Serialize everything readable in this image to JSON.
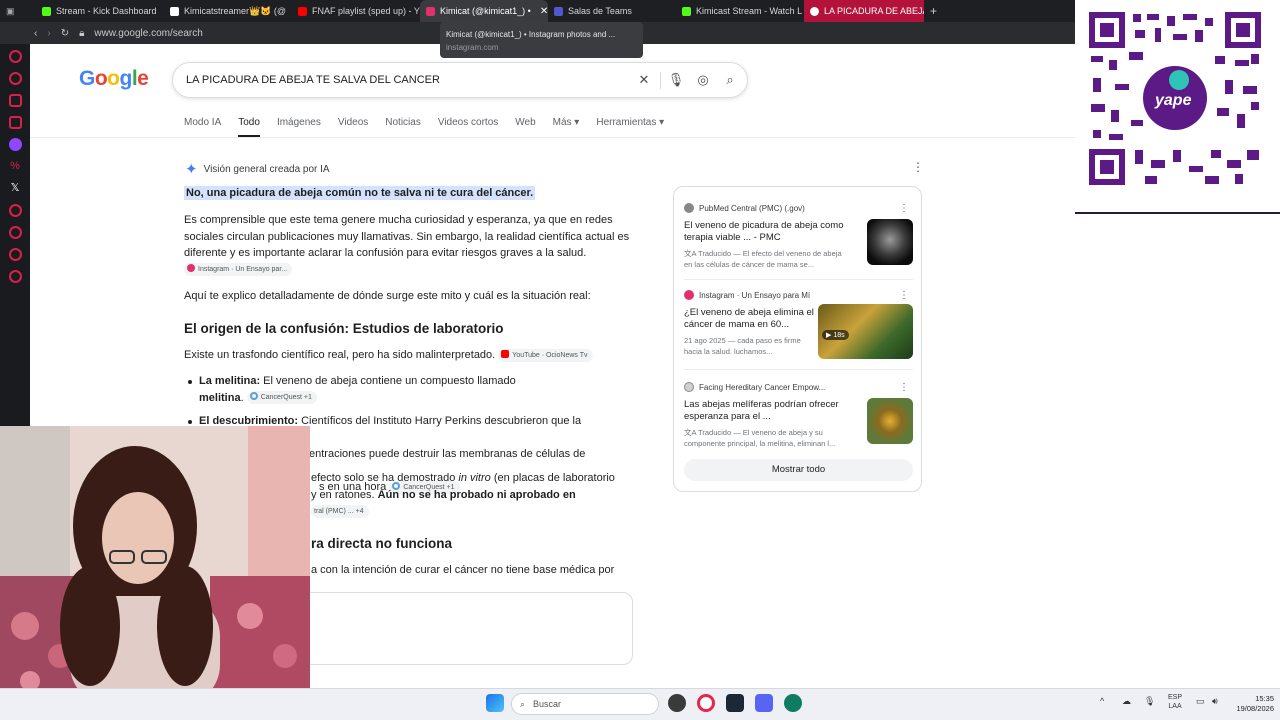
{
  "browser": {
    "tabs": [
      {
        "label": "Stream - Kick Dashboard",
        "color": "#53fc18"
      },
      {
        "label": "Kimicatstreamer👑🐱 (@",
        "color": "#222222"
      },
      {
        "label": "FNAF playlist (sped up) - Y",
        "color": "#ff0000"
      },
      {
        "label": "Kimicat (@kimicat1_) •",
        "color": "#e1306c",
        "active": true
      },
      {
        "label": "Salas de Teams",
        "color": "#5059c9"
      },
      {
        "label": "Kimicast Stream - Watch L",
        "color": "#53fc18"
      },
      {
        "label": "LA PICADURA DE ABEJA T",
        "color": "#ffffff",
        "current": true
      }
    ],
    "url": "www.google.com/search",
    "tooltip": {
      "title": "Kimicat (@kimicat1_) • Instagram photos and ...",
      "domain": "instagram.com"
    }
  },
  "google": {
    "logo": "Google",
    "query": "LA PICADURA DE ABEJA TE SALVA DEL CANCER",
    "tabs": [
      "Modo IA",
      "Todo",
      "Imágenes",
      "Videos",
      "Noticias",
      "Videos cortos",
      "Web",
      "Más ▾",
      "Herramientas ▾"
    ],
    "active_tab": "Todo"
  },
  "ai_overview": {
    "header": "Visión general creada por IA",
    "answer": "No, una picadura de abeja común no te salva ni te cura del cáncer.",
    "p1": "Es comprensible que este tema genere mucha curiosidad y esperanza, ya que en redes sociales circulan publicaciones muy llamativas. Sin embargo, la realidad científica actual es diferente y es importante aclarar la confusión para evitar riesgos graves a la salud.",
    "p1_chip": "Instagram · Un Ensayo par...",
    "p2": "Aquí te explico detalladamente de dónde surge este mito y cuál es la situación real:",
    "h_origin": "El origen de la confusión: Estudios de laboratorio",
    "origin_text": "Existe un trasfondo científico real, pero ha sido malinterpretado.",
    "origin_chip": "YouTube · OcioNews Tv",
    "b1_label": "La melitina:",
    "b1_text": " El veneno de abeja contiene un compuesto llamado",
    "b1_bold": "melitina",
    "b1_chip": "CancerQuest +1",
    "b2_label": "El descubrimiento:",
    "b2_text": " Científicos del Instituto Harry Perkins descubrieron que la melitina",
    "b2_line2": "entraciones puede destruir las membranas de células de cáncer",
    "b2_line3": "s en una hora",
    "b2_chip": "CancerQuest +1",
    "b3_line1a": "efecto solo se ha demostrado ",
    "b3_italic": "in vitro",
    "b3_line1b": " (en placas de laboratorio",
    "b3_line2a": "y en ratones. ",
    "b3_bold": "Aún no se ha probado ni aprobado en",
    "b3_chip": "tral (PMC) ... +4",
    "h_direct": "ra directa no funciona",
    "direct_text": "a con la intención de curar el cáncer no tiene base médica por"
  },
  "sources": {
    "items": [
      {
        "site": "PubMed Central (PMC) (.gov)",
        "title": "El veneno de picadura de abeja como terapia viable ... - PMC",
        "snippet": "Traducido — El efecto del veneno de abeja en las células de cáncer de mama se..."
      },
      {
        "site": "Instagram · Un Ensayo para Mí",
        "title": "¿El veneno de abeja elimina el cáncer de mama en 60...",
        "snippet": "21 ago 2025 — cada paso es firme hacia la salud. luchamos...",
        "badge": "18s"
      },
      {
        "site": "Facing Hereditary Cancer Empow...",
        "title": "Las abejas melíferas podrían ofrecer esperanza para el ...",
        "snippet": "Traducido — El veneno de abeja y su componente principal, la melitina, eliminan l..."
      }
    ],
    "show_all": "Mostrar todo"
  },
  "taskbar": {
    "search": "Buscar",
    "lang1": "ESP",
    "lang2": "LAA",
    "time": "15:35",
    "date": "19/08/2026"
  }
}
